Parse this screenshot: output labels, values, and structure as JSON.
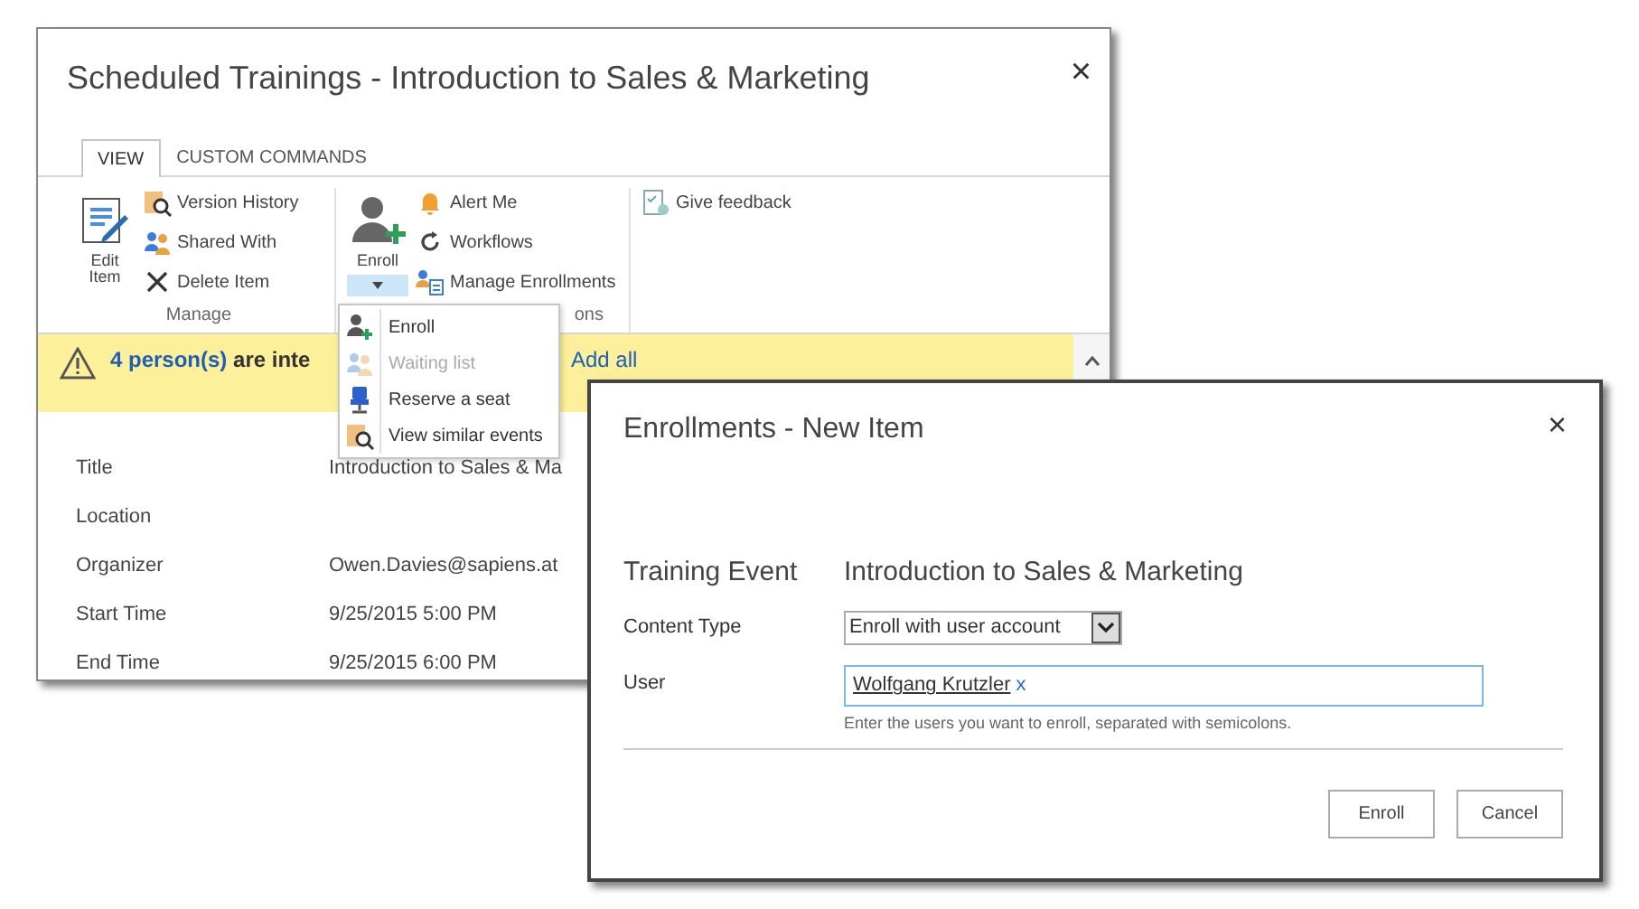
{
  "back_window": {
    "title": "Scheduled Trainings - Introduction to Sales & Marketing",
    "close": "×",
    "tabs": [
      {
        "label": "VIEW",
        "selected": true
      },
      {
        "label": "CUSTOM COMMANDS",
        "selected": false
      }
    ],
    "ribbon_groups": [
      {
        "label": "Manage",
        "big": {
          "label": "Edit Item"
        },
        "items": [
          {
            "label": "Version History"
          },
          {
            "label": "Shared With"
          },
          {
            "label": "Delete Item"
          }
        ]
      },
      {
        "label": "ons",
        "big": {
          "label": "Enroll",
          "dropdown_open": true
        },
        "items": [
          {
            "label": "Alert Me"
          },
          {
            "label": "Workflows"
          },
          {
            "label": "Manage Enrollments"
          }
        ]
      },
      {
        "items": [
          {
            "label": "Give feedback"
          }
        ]
      }
    ],
    "banner": {
      "text_bold": "4 person(s)",
      "text": "are inte",
      "link": "Add all"
    },
    "fields": [
      {
        "label": "Title",
        "value": "Introduction to Sales & Ma"
      },
      {
        "label": "Location"
      },
      {
        "label": "Organizer",
        "value": "Owen.Davies@sapiens.at"
      },
      {
        "label": "Start Time",
        "value": "9/25/2015 5:00 PM"
      },
      {
        "label": "End Time",
        "value": "9/25/2015 6:00 PM"
      }
    ]
  },
  "enroll_menu": [
    {
      "label": "Enroll",
      "disabled": false
    },
    {
      "label": "Waiting list",
      "disabled": true
    },
    {
      "label": "Reserve a seat",
      "disabled": false
    },
    {
      "label": "View similar events",
      "disabled": false
    }
  ],
  "dialog": {
    "title": "Enrollments - New Item",
    "close": "×",
    "training_event": {
      "label": "Training Event",
      "value": "Introduction to Sales & Marketing"
    },
    "content_type": {
      "label": "Content Type",
      "value": "Enroll with user account"
    },
    "user": {
      "label": "User",
      "value": "Wolfgang Krutzler",
      "remove": "x",
      "hint": "Enter the users you want to enroll, separated with semicolons."
    },
    "buttons": [
      "Enroll",
      "Cancel"
    ]
  }
}
